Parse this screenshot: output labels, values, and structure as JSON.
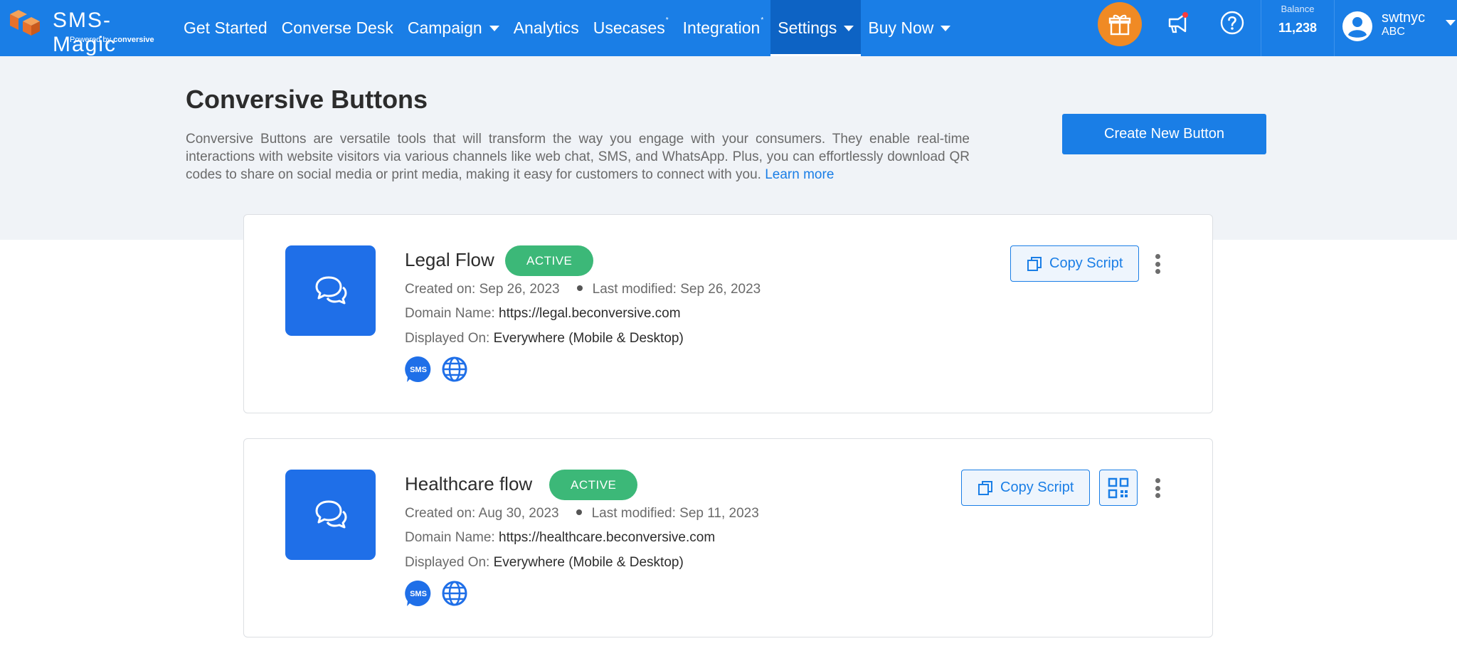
{
  "brand": {
    "name": "SMS-Magic",
    "powered_prefix": "Powered by",
    "powered_name": "conversive"
  },
  "nav": {
    "items": [
      {
        "label": "Get Started"
      },
      {
        "label": "Converse Desk"
      },
      {
        "label": "Campaign"
      },
      {
        "label": "Analytics"
      },
      {
        "label": "Usecases",
        "mark": "*"
      },
      {
        "label": "Integration",
        "mark": "*"
      },
      {
        "label": "Settings"
      },
      {
        "label": "Buy Now"
      }
    ],
    "active": "Settings",
    "balance_label": "Balance",
    "balance_value": "11,238",
    "user_name": "swtnyc",
    "user_org": "ABC",
    "icons": [
      "gift-icon",
      "megaphone-icon",
      "help-icon",
      "user-icon"
    ]
  },
  "page": {
    "title": "Conversive Buttons",
    "description": "Conversive Buttons are versatile tools that will transform the way you engage with your consumers. They enable real-time interactions with website visitors via various channels like web chat, SMS, and WhatsApp. Plus, you can effortlessly download QR codes to share on social media or print media, making it easy for customers to connect with you.",
    "learn_more": "Learn more",
    "create_button": "Create New Button"
  },
  "labels": {
    "created_on": "Created on:",
    "last_modified": "Last modified:",
    "domain_name": "Domain Name:",
    "displayed_on": "Displayed On:",
    "copy_script": "Copy Script",
    "sms": "SMS"
  },
  "buttons": [
    {
      "name": "Legal Flow",
      "status": "ACTIVE",
      "created": "Sep 26, 2023",
      "modified": "Sep 26, 2023",
      "domain": "https://legal.beconversive.com",
      "displayed": "Everywhere (Mobile & Desktop)",
      "has_qr": false
    },
    {
      "name": "Healthcare flow",
      "status": "ACTIVE",
      "created": "Aug 30, 2023",
      "modified": "Sep 11, 2023",
      "domain": "https://healthcare.beconversive.com",
      "displayed": "Everywhere (Mobile & Desktop)",
      "has_qr": true
    }
  ],
  "colors": {
    "primary": "#1a7ee6",
    "active_badge": "#3cb878",
    "gift": "#f08a24",
    "hero_bg": "#f0f3f7"
  }
}
